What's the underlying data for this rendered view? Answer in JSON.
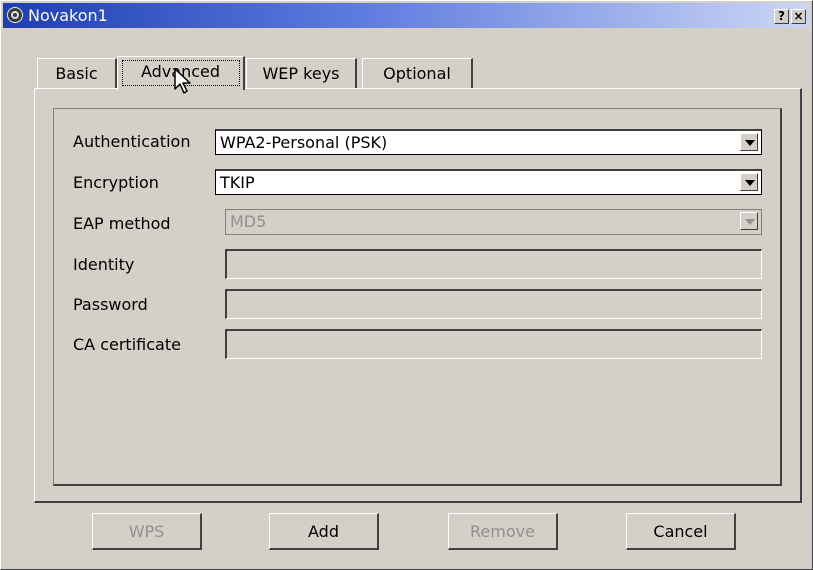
{
  "window": {
    "title": "Novakon1",
    "help_label": "?",
    "close_label": "×"
  },
  "tabs": [
    {
      "label": "Basic",
      "active": false
    },
    {
      "label": "Advanced",
      "active": true
    },
    {
      "label": "WEP keys",
      "active": false
    },
    {
      "label": "Optional",
      "active": false
    }
  ],
  "advanced": {
    "authentication": {
      "label": "Authentication",
      "value": "WPA2-Personal (PSK)"
    },
    "encryption": {
      "label": "Encryption",
      "value": "TKIP"
    },
    "eap_method": {
      "label": "EAP method",
      "value": "MD5",
      "enabled": false
    },
    "identity": {
      "label": "Identity",
      "value": ""
    },
    "password": {
      "label": "Password",
      "value": ""
    },
    "ca_certificate": {
      "label": "CA certificate",
      "value": ""
    }
  },
  "buttons": {
    "wps": "WPS",
    "add": "Add",
    "remove": "Remove",
    "cancel": "Cancel"
  },
  "colors": {
    "titlebar_start": "#1e3fb4",
    "titlebar_end": "#ccd6f4",
    "face": "#d4d0c8"
  }
}
